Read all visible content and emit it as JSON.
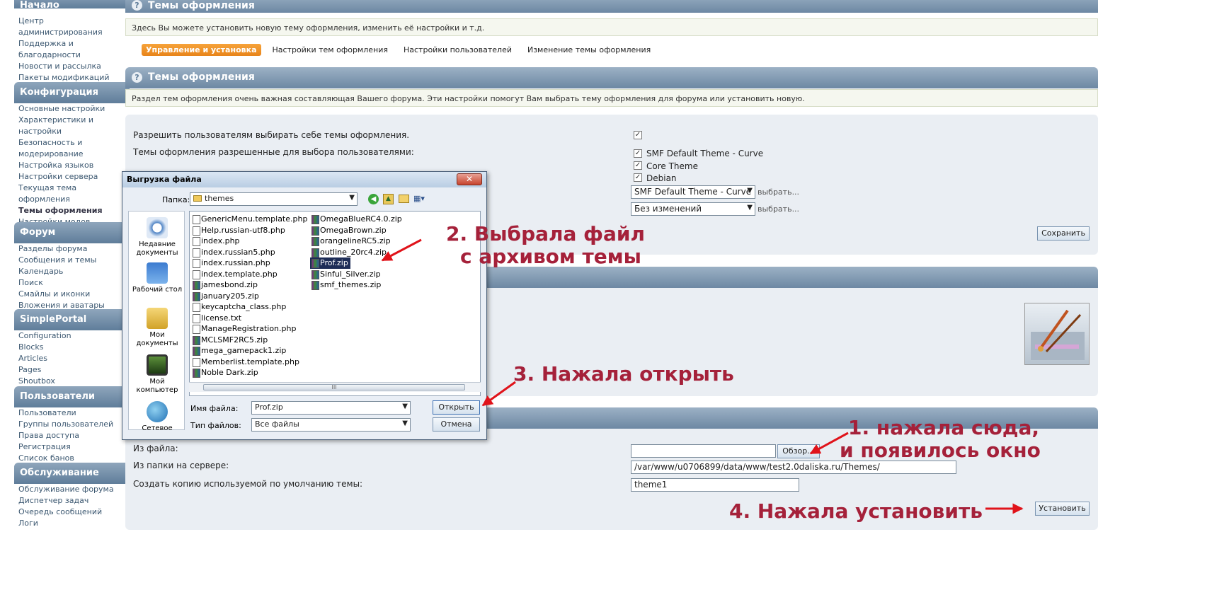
{
  "sidebar": {
    "sections": [
      {
        "title": "Начало",
        "items": [
          "Центр администрирования",
          "Поддержка и благодарности",
          "Новости и рассылка",
          "Пакеты модификаций"
        ]
      },
      {
        "title": "Конфигурация",
        "items": [
          "Основные настройки",
          "Характеристики и настройки",
          "Безопасность и модерирование",
          "Настройка языков",
          "Настройки сервера",
          "Текущая тема оформления",
          "Темы оформления",
          "Настройки модов"
        ]
      },
      {
        "title": "Форум",
        "items": [
          "Разделы форума",
          "Сообщения и темы",
          "Календарь",
          "Поиск",
          "Смайлы и иконки",
          "Вложения и аватары"
        ]
      },
      {
        "title": "SimplePortal",
        "items": [
          "Configuration",
          "Blocks",
          "Articles",
          "Pages",
          "Shoutbox"
        ]
      },
      {
        "title": "Пользователи",
        "items": [
          "Пользователи",
          "Группы пользователей",
          "Права доступа",
          "Регистрация",
          "Список банов"
        ]
      },
      {
        "title": "Обслуживание",
        "items": [
          "Обслуживание форума",
          "Диспетчер задач",
          "Очередь сообщений",
          "Логи"
        ]
      }
    ]
  },
  "header": {
    "title": "Темы оформления",
    "description": "Здесь Вы можете установить новую тему оформления, изменить её настройки и т.д.",
    "tabs": [
      "Управление и установка",
      "Настройки тем оформления",
      "Настройки пользователей",
      "Изменение темы оформления"
    ]
  },
  "themes_section": {
    "title": "Темы оформления",
    "description": "Раздел тем оформления очень важная составляющая Вашего форума. Эти настройки помогут Вам выбрать тему оформления для форума или установить новую.",
    "allow_label": "Разрешить пользователям выбирать себе темы оформления.",
    "allowed_label": "Темы оформления разрешенные для выбора пользователями:",
    "allowed_themes": [
      "SMF Default Theme - Curve",
      "Core Theme",
      "Debian"
    ],
    "default_select": "SMF Default Theme - Curve",
    "reset_select": "Без изменений",
    "choose_link": "выбрать...",
    "save_button": "Сохранить"
  },
  "install_section": {
    "from_file_label": "Из файла:",
    "browse_button": "Обзор...",
    "from_dir_label": "Из папки на сервере:",
    "dir_value": "/var/www/u0706899/data/www/test2.0daliska.ru/Themes/",
    "copy_label": "Создать копию используемой по умолчанию темы:",
    "copy_value": "theme1",
    "install_button": "Установить"
  },
  "dialog": {
    "title": "Выгрузка файла",
    "close": "✕",
    "folder_label": "Папка:",
    "folder_value": "themes",
    "places": [
      "Недавние документы",
      "Рабочий стол",
      "Мои документы",
      "Мой компьютер",
      "Сетевое"
    ],
    "files_col1": [
      "GenericMenu.template.php",
      "Help.russian-utf8.php",
      "index.php",
      "index.russian5.php",
      "index.russian.php",
      "index.template.php",
      "jamesbond.zip",
      "january205.zip",
      "keycaptcha_class.php",
      "license.txt",
      "ManageRegistration.php",
      "MCLSMF2RC5.zip",
      "mega_gamepack1.zip",
      "Memberlist.template.php",
      "Noble Dark.zip"
    ],
    "files_col2": [
      "OmegaBlueRC4.0.zip",
      "OmegaBrown.zip",
      "orangelineRC5.zip",
      "outline_20rc4.zip",
      "Prof.zip",
      "Sinful_Silver.zip",
      "smf_themes.zip"
    ],
    "filename_label": "Имя файла:",
    "filename_value": "Prof.zip",
    "filetype_label": "Тип файлов:",
    "filetype_value": "Все файлы",
    "open_button": "Открыть",
    "cancel_button": "Отмена",
    "scroll_grip": "III"
  },
  "annotations": {
    "step2_line1": "2. Выбрала файл",
    "step2_line2": "с архивом темы",
    "step3": "3. Нажала открыть",
    "step1_line1": "1. нажала сюда,",
    "step1_line2": "и появилось окно",
    "step4": "4. Нажала установить"
  },
  "colors": {
    "accent": "#e8841a",
    "annotation": "#a5213a",
    "titlebar": "#6d88a3"
  }
}
